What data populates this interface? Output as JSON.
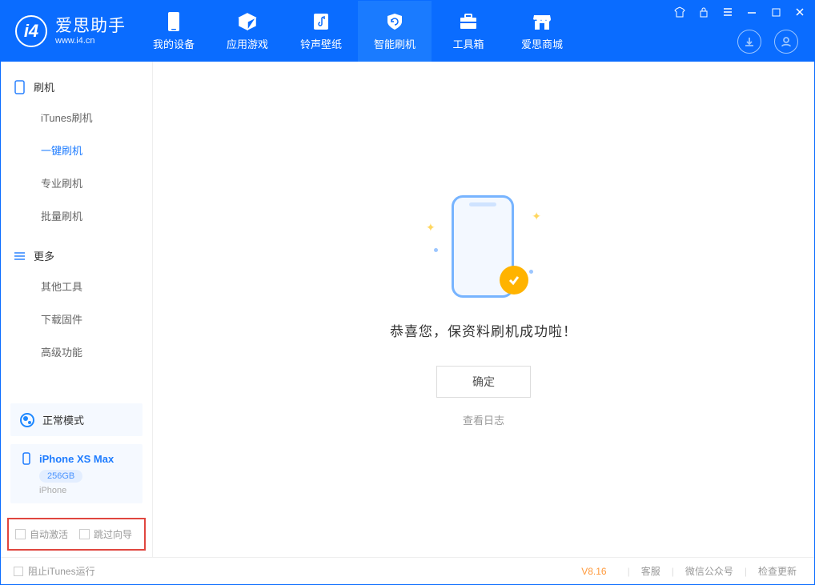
{
  "brand": {
    "title": "爱思助手",
    "url": "www.i4.cn"
  },
  "tabs": {
    "device": "我的设备",
    "apps": "应用游戏",
    "ringtone": "铃声壁纸",
    "flash": "智能刷机",
    "toolbox": "工具箱",
    "store": "爱思商城"
  },
  "sidebar": {
    "section_flash": "刷机",
    "items_flash": {
      "itunes": "iTunes刷机",
      "oneclick": "一键刷机",
      "pro": "专业刷机",
      "batch": "批量刷机"
    },
    "section_more": "更多",
    "items_more": {
      "other": "其他工具",
      "download": "下载固件",
      "advanced": "高级功能"
    }
  },
  "mode": {
    "label": "正常模式"
  },
  "device": {
    "name": "iPhone XS Max",
    "capacity": "256GB",
    "subtitle": "iPhone"
  },
  "options": {
    "auto_activate": "自动激活",
    "skip_guide": "跳过向导"
  },
  "result": {
    "message": "恭喜您，保资料刷机成功啦！",
    "ok": "确定",
    "view_log": "查看日志"
  },
  "footer": {
    "block_itunes": "阻止iTunes运行",
    "version": "V8.16",
    "support": "客服",
    "wechat": "微信公众号",
    "update": "检查更新"
  }
}
